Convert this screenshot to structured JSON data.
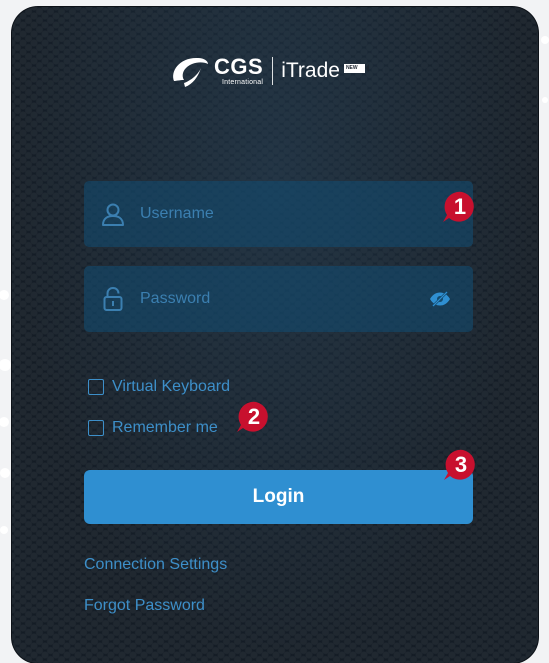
{
  "brand": {
    "name": "CGS",
    "sub": "International",
    "product": "iTrade",
    "badge": "NEW"
  },
  "form": {
    "username_placeholder": "Username",
    "password_placeholder": "Password",
    "virtual_keyboard_label": "Virtual Keyboard",
    "remember_me_label": "Remember me",
    "login_label": "Login"
  },
  "links": {
    "connection_settings": "Connection Settings",
    "forgot_password": "Forgot Password"
  },
  "markers": [
    "1",
    "2",
    "3"
  ],
  "icons": {
    "user": "user-icon",
    "lock": "lock-icon",
    "eye": "eye-slash-icon",
    "logo": "cgs-logo-icon"
  },
  "colors": {
    "card_bg": "#141c25",
    "field_bg": "#144b6e",
    "accent": "#2f8fd1",
    "link": "#3d8fc9",
    "marker": "#c8102e"
  }
}
